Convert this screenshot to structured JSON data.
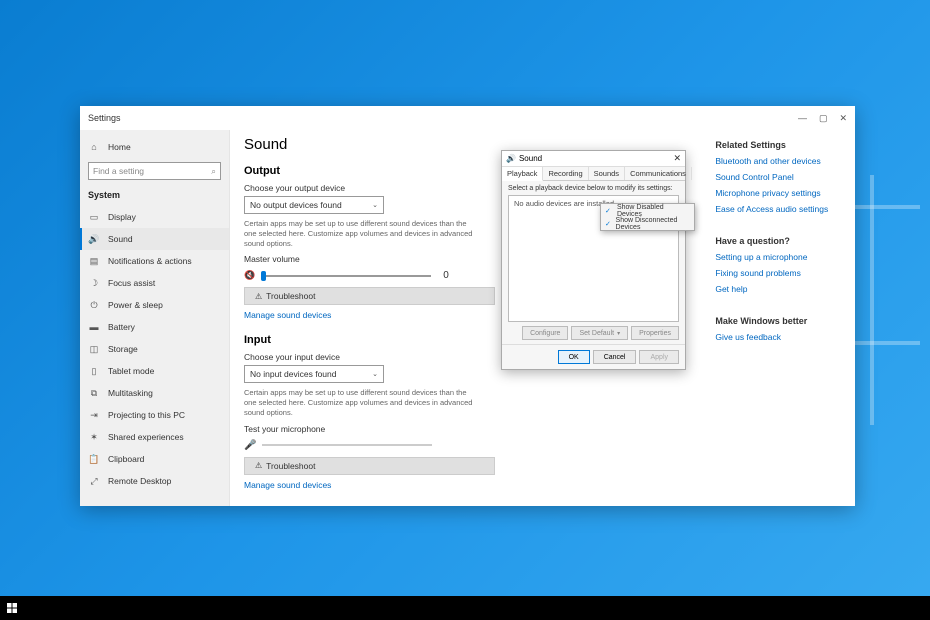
{
  "settings_window": {
    "title": "Settings",
    "sidebar": {
      "home_label": "Home",
      "search_placeholder": "Find a setting",
      "heading": "System",
      "items": [
        {
          "label": "Display"
        },
        {
          "label": "Sound"
        },
        {
          "label": "Notifications & actions"
        },
        {
          "label": "Focus assist"
        },
        {
          "label": "Power & sleep"
        },
        {
          "label": "Battery"
        },
        {
          "label": "Storage"
        },
        {
          "label": "Tablet mode"
        },
        {
          "label": "Multitasking"
        },
        {
          "label": "Projecting to this PC"
        },
        {
          "label": "Shared experiences"
        },
        {
          "label": "Clipboard"
        },
        {
          "label": "Remote Desktop"
        }
      ]
    },
    "main": {
      "page_title": "Sound",
      "output": {
        "heading": "Output",
        "choose_label": "Choose your output device",
        "selected": "No output devices found",
        "description": "Certain apps may be set up to use different sound devices than the one selected here. Customize app volumes and devices in advanced sound options.",
        "master_label": "Master volume",
        "master_value": "0",
        "troubleshoot": "Troubleshoot",
        "manage_link": "Manage sound devices"
      },
      "input": {
        "heading": "Input",
        "choose_label": "Choose your input device",
        "selected": "No input devices found",
        "description": "Certain apps may be set up to use different sound devices than the one selected here. Customize app volumes and devices in advanced sound options.",
        "test_label": "Test your microphone",
        "troubleshoot": "Troubleshoot",
        "manage_link": "Manage sound devices"
      }
    },
    "right": {
      "related_heading": "Related Settings",
      "related_links": [
        "Bluetooth and other devices",
        "Sound Control Panel",
        "Microphone privacy settings",
        "Ease of Access audio settings"
      ],
      "question_heading": "Have a question?",
      "question_links": [
        "Setting up a microphone",
        "Fixing sound problems",
        "Get help"
      ],
      "better_heading": "Make Windows better",
      "better_link": "Give us feedback"
    }
  },
  "sound_dialog": {
    "title": "Sound",
    "tabs": [
      "Playback",
      "Recording",
      "Sounds",
      "Communications"
    ],
    "instruction": "Select a playback device below to modify its settings:",
    "empty_text": "No audio devices are installed",
    "btn_configure": "Configure",
    "btn_setdefault": "Set Default",
    "btn_properties": "Properties",
    "btn_ok": "OK",
    "btn_cancel": "Cancel",
    "btn_apply": "Apply"
  },
  "context_menu": {
    "items": [
      "Show Disabled Devices",
      "Show Disconnected Devices"
    ]
  }
}
